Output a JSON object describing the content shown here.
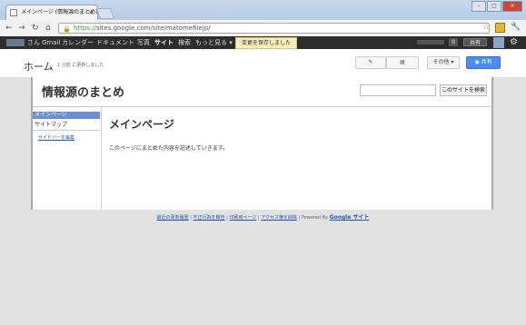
{
  "browser": {
    "tab_title": "メインページ (情報源のまとめ)",
    "tab_close": "×",
    "url_scheme": "https://",
    "url_rest": "sites.google.com/site/matomefilejp/",
    "win_min": "–",
    "win_max": "□",
    "win_close": "×"
  },
  "gbar": {
    "items": [
      "さん",
      "Gmail",
      "カレンダー",
      "ドキュメント",
      "写真",
      "サイト",
      "検索",
      "もっと見る ▾"
    ],
    "notice": "変更を保存しました",
    "count": "0",
    "share": "共有"
  },
  "sitebar": {
    "home": "ホーム",
    "updated": "1 分前 に更新しました",
    "more_actions": "その他 ▾",
    "share_button": "共有"
  },
  "site": {
    "title": "情報源のまとめ",
    "search_button": "このサイトを検索",
    "sidebar_selected": "メインページ",
    "sidebar_item": "サイトマップ",
    "sidebar_edit": "サイドバーを編集",
    "page_title": "メインページ",
    "page_body": "このページにまとめた内容を記述していきます。"
  },
  "footer": {
    "links": [
      "最近の更新履歴",
      "不正行為を報告",
      "印刷用ページ",
      "アクセス権を削除"
    ],
    "powered": "Powered By",
    "brand": "Google サイト"
  }
}
